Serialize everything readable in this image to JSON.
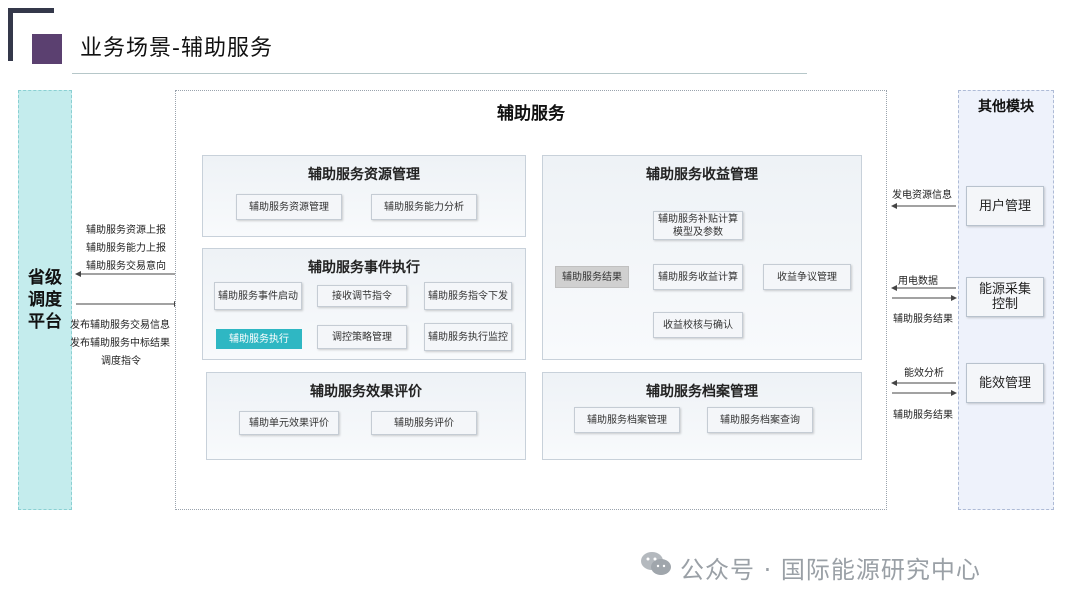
{
  "header": {
    "title": "业务场景-辅助服务"
  },
  "left": {
    "label": "省级调度平台"
  },
  "left_arrows": {
    "upward": [
      "辅助服务资源上报",
      "辅助服务能力上报",
      "辅助服务交易意向"
    ],
    "downward": [
      "发布辅助服务交易信息",
      "发布辅助服务中标结果",
      "调度指令"
    ]
  },
  "main": {
    "title": "辅助服务",
    "resource": {
      "title": "辅助服务资源管理",
      "items": [
        "辅助服务资源管理",
        "辅助服务能力分析"
      ]
    },
    "event": {
      "title": "辅助服务事件执行",
      "items": [
        "辅助服务事件启动",
        "接收调节指令",
        "辅助服务指令下发",
        "辅助服务执行",
        "调控策略管理",
        "辅助服务执行监控"
      ]
    },
    "evaluation": {
      "title": "辅助服务效果评价",
      "items": [
        "辅助单元效果评价",
        "辅助服务评价"
      ]
    },
    "revenue": {
      "title": "辅助服务收益管理",
      "items": [
        "辅助服务补贴计算模型及参数",
        "辅助服务结果",
        "辅助服务收益计算",
        "收益争议管理",
        "收益校核与确认"
      ]
    },
    "archive": {
      "title": "辅助服务档案管理",
      "items": [
        "辅助服务档案管理",
        "辅助服务档案查询"
      ]
    }
  },
  "right": {
    "title": "其他模块",
    "modules": [
      "用户管理",
      "能源采集控制",
      "能效管理"
    ],
    "arrow_labels": [
      "发电资源信息",
      "用电数据",
      "辅助服务结果",
      "能效分析",
      "辅助服务结果"
    ]
  },
  "watermark": {
    "text": "公众号 · 国际能源研究中心"
  },
  "colors": {
    "left_fill": "#c4eced",
    "teal": "#2fb7c3",
    "logo": "#5b4070"
  }
}
